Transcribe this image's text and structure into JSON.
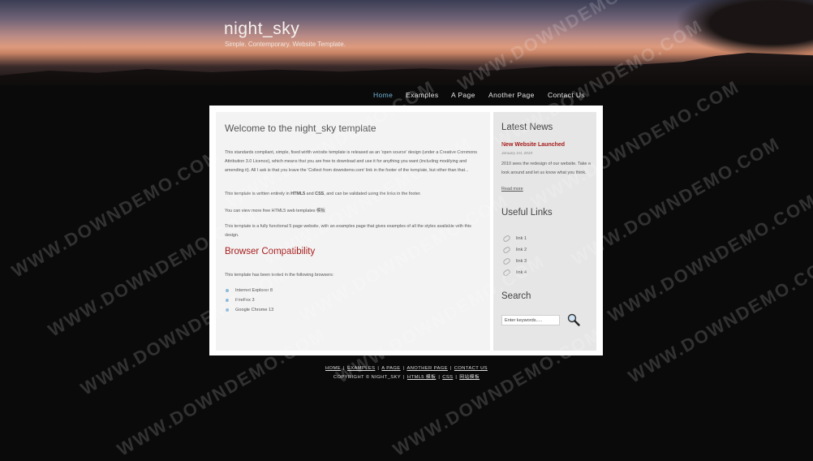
{
  "header": {
    "title": "night_sky",
    "slogan": "Simple. Contemporary. Website Template."
  },
  "nav": {
    "items": [
      "Home",
      "Examples",
      "A Page",
      "Another Page",
      "Contact Us"
    ],
    "active": "Home"
  },
  "main": {
    "welcome_heading": "Welcome to the night_sky template",
    "intro_paragraph": "This standards compliant, simple, fixed width website template is released as an 'open source' design (under a Creative Commons Attribution 3.0 Licence), which means that you are free to download and use it for anything you want (including modifying and amending it). All I ask is that you leave the 'Collect from downdemo.com' link in the footer of the template, but other than that...",
    "html5_css": {
      "before": "This template is written entirely in ",
      "html5": "HTML5",
      "and": " and ",
      "css": "CSS",
      "after": ", and can be validated using the links in the footer."
    },
    "more_templates": "You can view more free HTML5 web templates 模板",
    "functional": "This template is a fully functional 5 page website, with an examples page that gives examples of all the styles available with this design.",
    "compat_heading": "Browser Compatibility",
    "compat_intro": "This template has been tested in the following browsers:",
    "browsers": [
      "Internet Explorer 8",
      "FireFox 3",
      "Google Chrome 13"
    ]
  },
  "sidebar": {
    "news_heading": "Latest News",
    "news_title": "New Website Launched",
    "news_date": "January 1st, 2010",
    "news_body": "2010 sees the redesign of our website. Take a look around and let us know what you think.",
    "read_more": "Read more",
    "links_heading": "Useful Links",
    "links": [
      "link 1",
      "link 2",
      "link 3",
      "link 4"
    ],
    "search_heading": "Search",
    "search_placeholder": "Enter keywords....."
  },
  "footer": {
    "links": [
      "HOME",
      "EXAMPLES",
      "A PAGE",
      "ANOTHER PAGE",
      "CONTACT US"
    ],
    "copyright": "COPYRIGHT © NIGHT_SKY",
    "html5_link": "HTML5 模板",
    "css_link": "CSS",
    "site_link": "网站模板"
  },
  "watermark": "WWW.DOWNDEMO.COM",
  "colors": {
    "background": "#0b0a0a",
    "nav_active": "#6fb3d6",
    "heading_red": "#a61c1c",
    "main_panel": "#f3f3f3",
    "sidebar_panel": "#e6e6e6"
  }
}
